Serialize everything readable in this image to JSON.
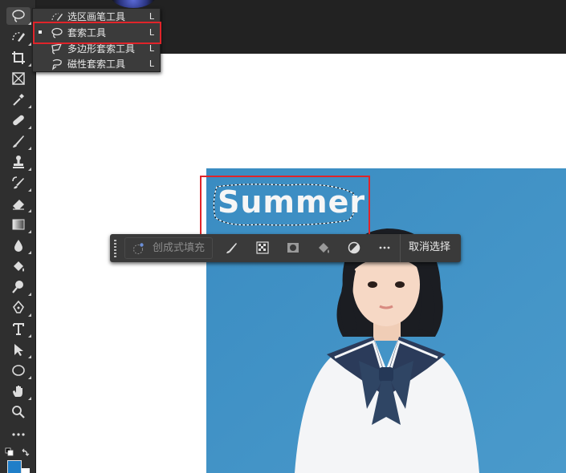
{
  "flyout": {
    "items": [
      {
        "label": "选区画笔工具",
        "key": "L",
        "active": false
      },
      {
        "label": "套索工具",
        "key": "L",
        "active": true
      },
      {
        "label": "多边形套索工具",
        "key": "L",
        "active": false
      },
      {
        "label": "磁性套索工具",
        "key": "L",
        "active": false
      }
    ]
  },
  "canvas": {
    "image_text": "Summer"
  },
  "taskbar": {
    "generative_fill_label": "创成式填充",
    "more_label": "···",
    "deselect_label": "取消选择"
  },
  "colors": {
    "foreground": "#1f7ec8",
    "background": "#ffffff",
    "highlight": "#e0242a"
  },
  "icons": {
    "toolbar": [
      "lasso-icon",
      "object-select-icon",
      "crop-icon",
      "frame-icon",
      "eyedropper-icon",
      "healing-brush-icon",
      "brush-icon",
      "clone-stamp-icon",
      "history-brush-icon",
      "eraser-icon",
      "gradient-icon",
      "blur-icon",
      "dodge-icon",
      "burn-icon",
      "pen-icon",
      "type-icon",
      "path-select-icon",
      "ellipse-icon",
      "hand-icon",
      "zoom-icon",
      "more-tools-icon"
    ]
  }
}
